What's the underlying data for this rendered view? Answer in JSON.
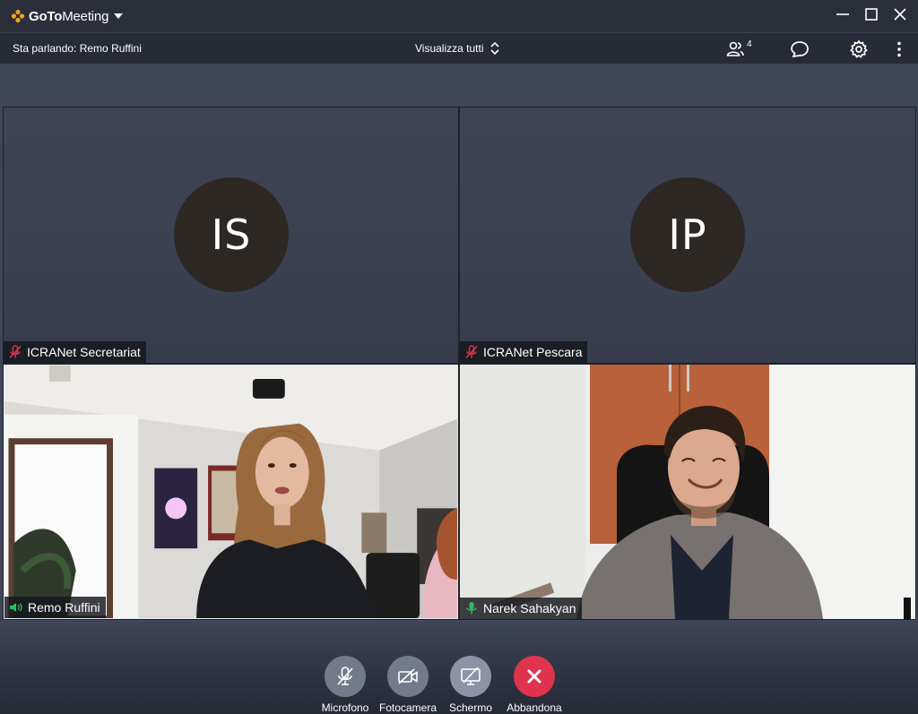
{
  "app": {
    "brand_bold": "GoTo",
    "brand_thin": "Meeting"
  },
  "toolbar": {
    "speaking": "Sta parlando: Remo Ruffini",
    "view_all": "Visualizza tutti",
    "participants_count": "4"
  },
  "tiles": [
    {
      "initials": "IS",
      "name": "ICRANet Secretariat",
      "mic": "muted"
    },
    {
      "initials": "IP",
      "name": "ICRANet Pescara",
      "mic": "muted"
    },
    {
      "name": "Remo Ruffini",
      "mic": "speaking"
    },
    {
      "name": "Narek Sahakyan",
      "mic": "on"
    }
  ],
  "controls": {
    "mic": "Microfono",
    "camera": "Fotocamera",
    "screen": "Schermo",
    "leave": "Abbandona"
  },
  "colors": {
    "muted_icon": "#e0334f",
    "leave_button": "#e0334f",
    "mic_on_icon": "#2ebd5e",
    "brand_orange": "#f5a31a"
  }
}
